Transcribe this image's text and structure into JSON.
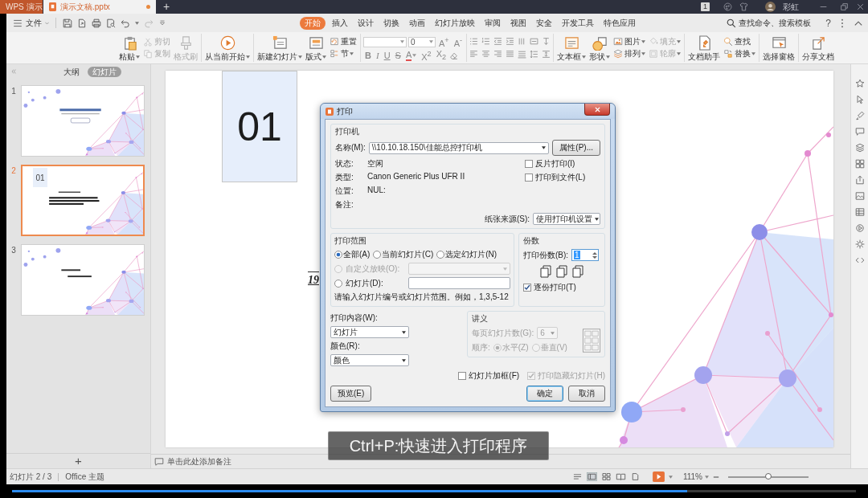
{
  "title_bar": {
    "tabs": [
      {
        "label": "WPS 演示",
        "kind": "app",
        "selected": false
      },
      {
        "label": "演示文稿.pptx",
        "kind": "document",
        "selected": true,
        "unsaved": true
      }
    ],
    "new_tab": "+",
    "badge": "1",
    "user_name": "彩虹"
  },
  "menu_bar": {
    "file_menu": "文件",
    "tabs": [
      {
        "label": "开始",
        "selected": true
      },
      {
        "label": "插入",
        "selected": false
      },
      {
        "label": "设计",
        "selected": false
      },
      {
        "label": "切换",
        "selected": false
      },
      {
        "label": "动画",
        "selected": false
      },
      {
        "label": "幻灯片放映",
        "selected": false
      },
      {
        "label": "审阅",
        "selected": false
      },
      {
        "label": "视图",
        "selected": false
      },
      {
        "label": "安全",
        "selected": false
      },
      {
        "label": "开发工具",
        "selected": false
      },
      {
        "label": "特色应用",
        "selected": false
      }
    ],
    "search": "查找命令、搜索模板",
    "help": "?"
  },
  "ribbon": {
    "groups": [
      {
        "kind": "buttons",
        "columns": [
          {
            "kind": "large",
            "items": [
              {
                "label": "粘贴",
                "dropdown": true,
                "disabled": false
              }
            ]
          },
          {
            "kind": "stack",
            "items": [
              {
                "label": "剪切",
                "dropdown": false,
                "disabled": true
              },
              {
                "label": "复制",
                "dropdown": false,
                "disabled": true
              }
            ]
          },
          {
            "kind": "large",
            "items": [
              {
                "label": "格式刷",
                "dropdown": false,
                "disabled": true
              }
            ]
          }
        ]
      },
      {
        "kind": "buttons",
        "columns": [
          {
            "kind": "large",
            "items": [
              {
                "label": "从当前开始",
                "dropdown": true,
                "disabled": false
              }
            ]
          }
        ]
      },
      {
        "kind": "buttons",
        "columns": [
          {
            "kind": "large",
            "items": [
              {
                "label": "新建幻灯片",
                "dropdown": true,
                "disabled": false
              }
            ]
          },
          {
            "kind": "large",
            "items": [
              {
                "label": "版式",
                "dropdown": true,
                "disabled": false
              }
            ]
          },
          {
            "kind": "stack",
            "items": [
              {
                "label": "重置",
                "dropdown": false,
                "disabled": false
              },
              {
                "label": "节",
                "dropdown": true,
                "disabled": false
              }
            ]
          }
        ]
      },
      {
        "kind": "font",
        "size": "0",
        "size_buttons": [
          "A$^{+}$",
          "A$^{-}$"
        ],
        "styles": [
          {
            "label": "B",
            "kind": "bold"
          },
          {
            "label": "I",
            "kind": "italic"
          },
          {
            "label": "U",
            "kind": "underline"
          },
          {
            "label": "S",
            "kind": "strike"
          },
          {
            "label": "A",
            "kind": "color"
          },
          {
            "label": "X$^{2}$",
            "kind": "superscript"
          },
          {
            "label": "X$_{2}$",
            "kind": "subscript"
          }
        ]
      },
      {
        "kind": "paragraph"
      },
      {
        "kind": "buttons",
        "columns": [
          {
            "kind": "large",
            "items": [
              {
                "label": "文本框",
                "dropdown": true,
                "disabled": false
              }
            ]
          },
          {
            "kind": "large",
            "items": [
              {
                "label": "形状",
                "dropdown": true,
                "disabled": false
              }
            ]
          },
          {
            "kind": "stack",
            "items": [
              {
                "label": "图片",
                "dropdown": true,
                "disabled": false
              },
              {
                "label": "排列",
                "dropdown": true,
                "disabled": false
              }
            ]
          },
          {
            "kind": "stack",
            "items": [
              {
                "label": "填充",
                "dropdown": true,
                "disabled": true
              },
              {
                "label": "轮廓",
                "dropdown": true,
                "disabled": true
              }
            ]
          }
        ]
      },
      {
        "kind": "buttons",
        "columns": [
          {
            "kind": "large",
            "items": [
              {
                "label": "文档助手",
                "dropdown": false,
                "disabled": false
              }
            ]
          },
          {
            "kind": "stack",
            "items": [
              {
                "label": "查找",
                "dropdown": false,
                "disabled": false
              },
              {
                "label": "替换",
                "dropdown": true,
                "disabled": false
              }
            ]
          }
        ]
      },
      {
        "kind": "buttons",
        "columns": [
          {
            "kind": "large",
            "items": [
              {
                "label": "选择窗格",
                "dropdown": false,
                "disabled": false
              }
            ]
          }
        ]
      },
      {
        "kind": "buttons",
        "columns": [
          {
            "kind": "large",
            "items": [
              {
                "label": "分享文档",
                "dropdown": false,
                "disabled": false
              }
            ]
          }
        ]
      }
    ]
  },
  "slides_panel": {
    "tabs": [
      {
        "label": "大纲",
        "selected": false
      },
      {
        "label": "幻灯片",
        "selected": true
      }
    ],
    "slides": [
      {
        "number": "1",
        "kind": "title",
        "selected": false
      },
      {
        "number": "2",
        "kind": "section",
        "label": "01",
        "selected": true
      },
      {
        "number": "3",
        "kind": "closing",
        "selected": false
      }
    ],
    "add_button": "+"
  },
  "slide": {
    "number_box": "01",
    "body_text": "19"
  },
  "notes": {
    "placeholder": "单击此处添加备注"
  },
  "caption": "Ctrl+P:快速进入打印程序",
  "status_bar": {
    "slide_position": "幻灯片 2 / 3",
    "theme": "Office 主题",
    "view_buttons": [
      {
        "selected": true
      },
      {
        "selected": false
      },
      {
        "selected": false
      },
      {
        "selected": false
      }
    ],
    "zoom": "111%",
    "zoom_slider": {
      "level": 0.5
    }
  },
  "video_progress": {
    "level": 0.8
  },
  "print_dialog": {
    "title": "打印",
    "printer_group": {
      "title": "打印机",
      "name_label": "名称(M):",
      "name_value": "\\\\10.10.18.150\\佳能总控打印机",
      "properties_button": "属性(P)...",
      "info": [
        {
          "label": "状态:",
          "value": "空闲"
        },
        {
          "label": "类型:",
          "value": "Canon Generic Plus UFR II"
        },
        {
          "label": "位置:",
          "value": "NUL:"
        },
        {
          "label": "备注:"
        }
      ],
      "options": [
        {
          "label": "反片打印(I)",
          "checked": false
        },
        {
          "label": "打印到文件(L)",
          "checked": false
        }
      ],
      "paper_source_label": "纸张来源(S):",
      "paper_source_value": "使用打印机设置"
    },
    "range_group": {
      "title": "打印范围",
      "options": [
        {
          "label": "全部(A)",
          "kind": "radio",
          "selected": true,
          "disabled": false
        },
        {
          "label": "当前幻灯片(C)",
          "kind": "radio",
          "selected": false,
          "disabled": false
        },
        {
          "label": "选定幻灯片(N)",
          "kind": "radio",
          "selected": false,
          "disabled": false
        },
        {
          "label": "自定义放映(O):",
          "kind": "radio_dropdown",
          "selected": false,
          "disabled": true
        },
        {
          "label": "幻灯片(D):",
          "kind": "radio_input",
          "selected": false,
          "disabled": false
        }
      ],
      "hint": "请输入幻灯片编号或幻灯片范围。例如，1,3,5-12"
    },
    "copies_group": {
      "title": "份数",
      "count_label": "打印份数(B):",
      "count_value": "1",
      "count_highlighted": true,
      "collate": {
        "label": "逐份打印(T)",
        "checked": true
      }
    },
    "content": {
      "label": "打印内容(W):",
      "value": "幻灯片"
    },
    "color": {
      "label": "颜色(R):",
      "value": "颜色"
    },
    "handout_group": {
      "title": "讲义",
      "disabled": true,
      "per_page_label": "每页幻灯片数(G):",
      "per_page_value": "6",
      "order_label": "顺序:",
      "order_options": [
        {
          "label": "水平(Z)",
          "selected": true
        },
        {
          "label": "垂直(V)",
          "selected": false
        }
      ]
    },
    "frame_option": {
      "label": "幻灯片加框(F)",
      "checked": false,
      "disabled": false
    },
    "hidden_option": {
      "label": "打印隐藏幻灯片(H)",
      "checked": true,
      "disabled": true
    },
    "buttons": [
      {
        "label": "预览(E)",
        "kind": "secondary"
      },
      {
        "label": "确定",
        "kind": "default"
      },
      {
        "label": "取消",
        "kind": "secondary"
      }
    ]
  }
}
